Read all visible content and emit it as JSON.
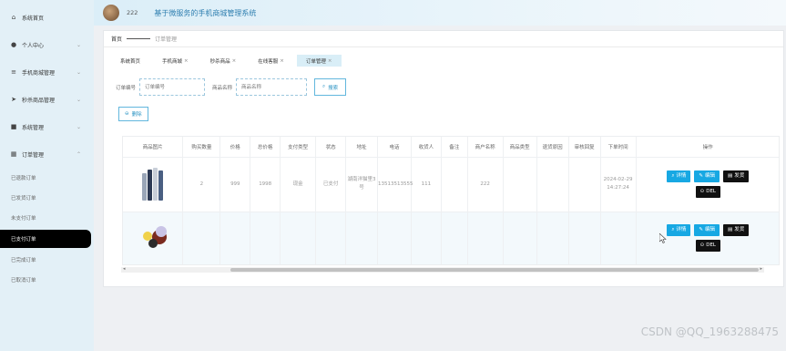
{
  "header": {
    "user": "222",
    "title": "基于微服务的手机商城管理系统"
  },
  "sidebar": {
    "items": [
      {
        "label": "系统首页",
        "icon": "home-icon",
        "glyph": "⌂",
        "chevron": false
      },
      {
        "label": "个人中心",
        "icon": "person-icon",
        "glyph": "●",
        "chevron": true
      },
      {
        "label": "手机商城管理",
        "icon": "list-icon",
        "glyph": "≡",
        "chevron": true
      },
      {
        "label": "秒杀商品管理",
        "icon": "send-icon",
        "glyph": "➤",
        "chevron": true
      },
      {
        "label": "系统管理",
        "icon": "book-icon",
        "glyph": "■",
        "chevron": true
      },
      {
        "label": "订单管理",
        "icon": "grid-icon",
        "glyph": "▦",
        "chevron": true
      }
    ],
    "sub_items": [
      "已退款订单",
      "已发货订单",
      "未支付订单",
      "已支付订单",
      "已完成订单",
      "已取消订单"
    ],
    "active_sub": "已支付订单"
  },
  "breadcrumb": {
    "home": "首页",
    "current": "订单管理"
  },
  "tabs": [
    {
      "label": "系统首页",
      "closable": false
    },
    {
      "label": "手机商城",
      "closable": true
    },
    {
      "label": "秒杀商品",
      "closable": true
    },
    {
      "label": "在线客服",
      "closable": true
    },
    {
      "label": "订单管理",
      "closable": true,
      "active": true
    }
  ],
  "search": {
    "order_no_label": "订单编号",
    "order_no_placeholder": "订单编号",
    "product_name_label": "商品名称",
    "product_name_placeholder": "商品名称",
    "search_button": "搜索",
    "delete_button": "删除"
  },
  "table": {
    "columns": [
      "商品图片",
      "购买数量",
      "价格",
      "总价格",
      "支付类型",
      "状态",
      "地址",
      "电话",
      "收货人",
      "备注",
      "商户名称",
      "商品类型",
      "退货原因",
      "审核回复",
      "下单时间",
      "操作"
    ],
    "rows": [
      {
        "qty": "2",
        "price": "999",
        "total": "1998",
        "pay": "现金",
        "status": "已支付",
        "address": "湖南洋猫里3号",
        "phone": "13513513555",
        "receiver": "111",
        "note": "",
        "merchant": "222",
        "category": "",
        "return_reason": "",
        "review": "",
        "time": "2024-02-29 14:27:24"
      },
      {
        "qty": "",
        "price": "",
        "total": "",
        "pay": "",
        "status": "",
        "address": "",
        "phone": "",
        "receiver": "",
        "note": "",
        "merchant": "",
        "category": "",
        "return_reason": "",
        "review": "",
        "time": ""
      }
    ],
    "actions": {
      "detail": "详情",
      "edit": "编辑",
      "ship": "发货",
      "del": "DEL"
    }
  },
  "watermark": "CSDN @QQ_1963288475",
  "colors": {
    "accent": "#17a8e3",
    "sidebar_bg": "#e3f0f7",
    "header_title": "#2f7fb0"
  }
}
